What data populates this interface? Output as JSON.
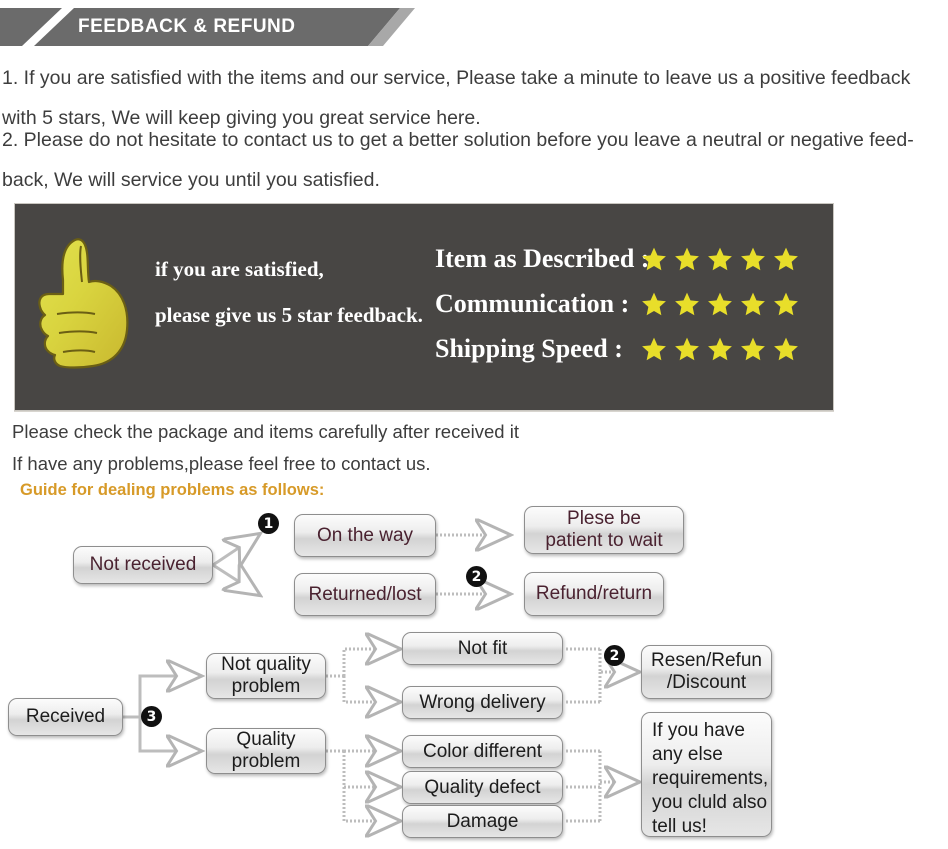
{
  "header": {
    "title": "FEEDBACK & REFUND"
  },
  "intro": {
    "para1": "1. If you are satisfied with the items and our service, Please take a minute to leave us a positive feedback with 5 stars, We will keep giving you great service here.",
    "para2": "2. Please do not hesitate to contact us to get a better solution before you leave a neutral or negative feed-back, We will service you until you satisfied."
  },
  "feedback_banner": {
    "thumb_icon": "thumbs-up-icon",
    "line1": "if you are satisfied,",
    "line2": "please give us 5 star feedback.",
    "star_color": "#e8de2a",
    "background": "#484644",
    "ratings": [
      {
        "label": "Item as Described :",
        "stars": 5
      },
      {
        "label": "Communication :",
        "stars": 5
      },
      {
        "label": "Shipping Speed :",
        "stars": 5
      }
    ]
  },
  "notes": {
    "note1": "Please check the package and items carefully after received it",
    "note2": "If have any problems,please feel free to contact us.",
    "guide": "Guide for dealing problems as follows:",
    "guide_color": "#d79a28"
  },
  "flow1": {
    "nodes": [
      {
        "label": "Not received"
      },
      {
        "label": "On the way"
      },
      {
        "label": "Returned/lost"
      },
      {
        "label": "Plese be\npatient to wait"
      },
      {
        "label": "Refund/return"
      }
    ],
    "badges": [
      "❶",
      "❷"
    ],
    "badge1": "1",
    "badge2": "2"
  },
  "flow2": {
    "nodes": [
      {
        "label": "Received"
      },
      {
        "label": "Not quality\nproblem"
      },
      {
        "label": "Quality\nproblem"
      },
      {
        "label": "Not fit"
      },
      {
        "label": "Wrong delivery"
      },
      {
        "label": "Color different"
      },
      {
        "label": "Quality defect"
      },
      {
        "label": "Damage"
      },
      {
        "label": "Resen/Refun\n/Discount"
      },
      {
        "label": "If you have\nany else\nrequirements,\nyou cluld also\ntell us!"
      }
    ],
    "badge3": "3",
    "badge2": "2"
  }
}
